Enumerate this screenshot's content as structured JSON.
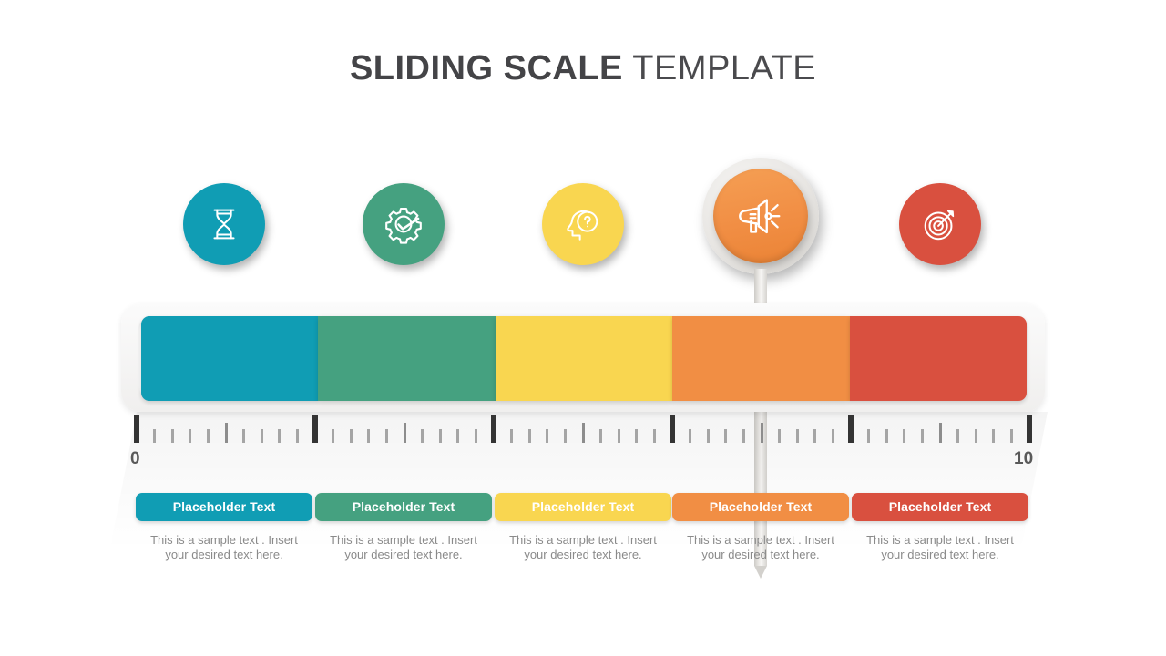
{
  "title": {
    "bold_part": "SLIDING SCALE",
    "light_part": " TEMPLATE"
  },
  "scale": {
    "min_label": "0",
    "max_label": "10",
    "pointer_value": "7",
    "major_tick_values": [
      "0",
      "2",
      "4",
      "6",
      "8",
      "10"
    ]
  },
  "colors": {
    "teal": "#109DB4",
    "green": "#45A180",
    "yellow": "#F9D650",
    "orange": "#F18E44",
    "red": "#D9503F",
    "ring": "#DEDCD8",
    "needle": "#E3E1DD",
    "title": "#444447",
    "body_text": "#8a8a8a",
    "tick_major": "#343434",
    "tick_minor": "#a5a5a5"
  },
  "steps": [
    {
      "index": 1,
      "icon": "hourglass-icon",
      "color": "#109DB4",
      "pill_label": "Placeholder Text",
      "body": "This is a sample text . Insert your desired text here.",
      "active": false
    },
    {
      "index": 2,
      "icon": "gear-check-icon",
      "color": "#45A180",
      "pill_label": "Placeholder Text",
      "body": "This is a sample text . Insert your desired text here.",
      "active": false
    },
    {
      "index": 3,
      "icon": "head-question-icon",
      "color": "#F9D650",
      "pill_label": "Placeholder Text",
      "body": "This is a sample text . Insert your desired text here.",
      "active": false
    },
    {
      "index": 4,
      "icon": "megaphone-icon",
      "color": "#F18E44",
      "pill_label": "Placeholder Text",
      "body": "This is a sample text . Insert your desired text here.",
      "active": true
    },
    {
      "index": 5,
      "icon": "target-icon",
      "color": "#D9503F",
      "pill_label": "Placeholder Text",
      "body": "This is a sample text . Insert your desired text here.",
      "active": false
    }
  ]
}
